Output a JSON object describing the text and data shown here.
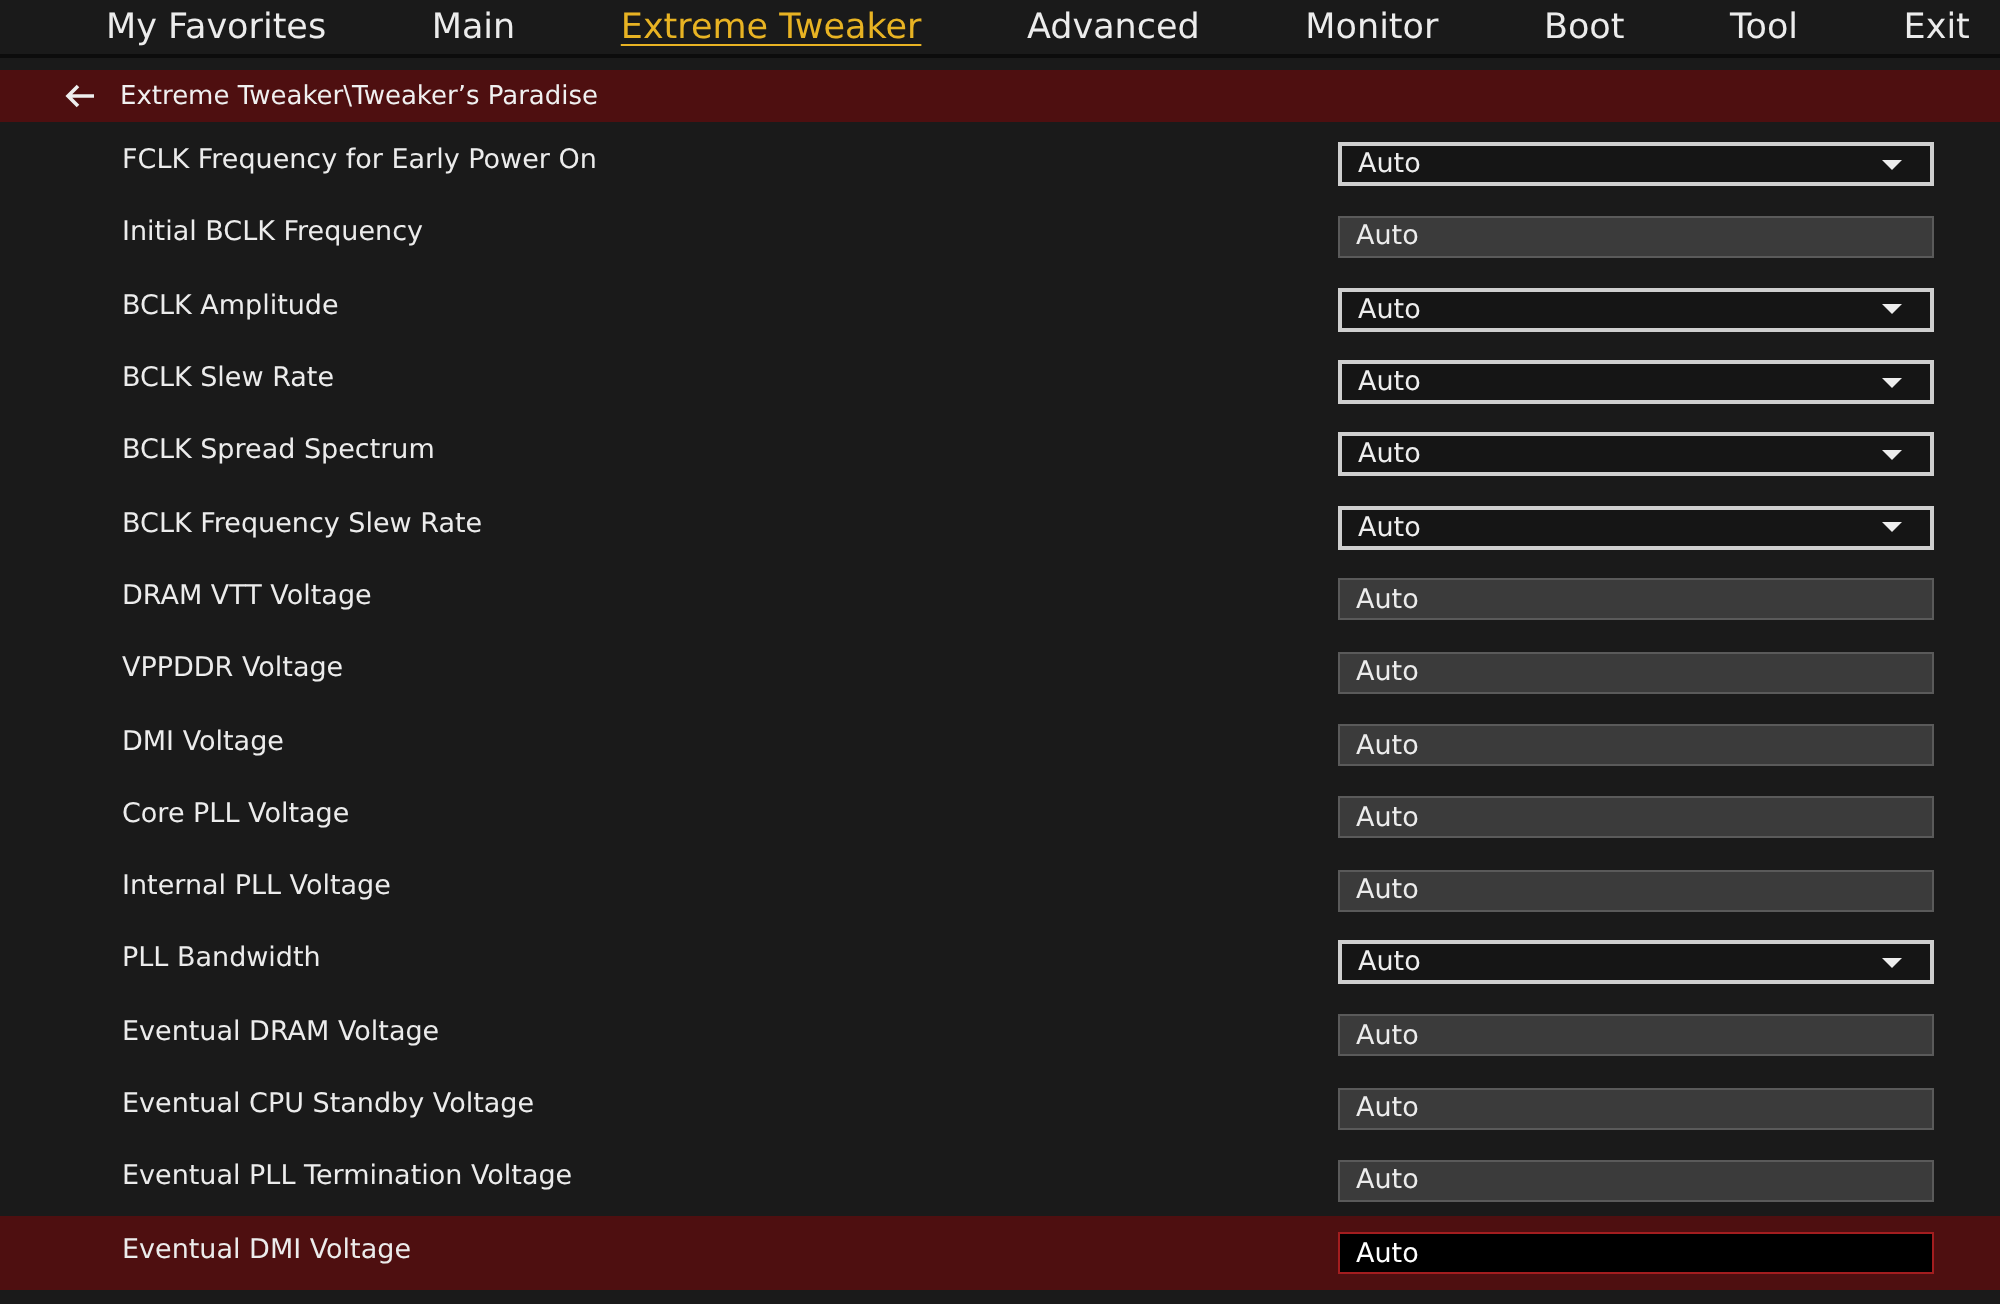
{
  "tabs": [
    {
      "label": "My Favorites",
      "selected": false
    },
    {
      "label": "Main",
      "selected": false
    },
    {
      "label": "Extreme Tweaker",
      "selected": true
    },
    {
      "label": "Advanced",
      "selected": false
    },
    {
      "label": "Monitor",
      "selected": false
    },
    {
      "label": "Boot",
      "selected": false
    },
    {
      "label": "Tool",
      "selected": false
    },
    {
      "label": "Exit",
      "selected": false
    }
  ],
  "breadcrumb": "Extreme Tweaker\\Tweaker’s Paradise",
  "settings": [
    {
      "label": "FCLK Frequency for Early Power On",
      "value": "Auto",
      "kind": "dropdown",
      "selected": false
    },
    {
      "label": "Initial BCLK Frequency",
      "value": "Auto",
      "kind": "field",
      "selected": false
    },
    {
      "label": "BCLK Amplitude",
      "value": "Auto",
      "kind": "dropdown",
      "selected": false
    },
    {
      "label": "BCLK Slew Rate",
      "value": "Auto",
      "kind": "dropdown",
      "selected": false
    },
    {
      "label": "BCLK Spread Spectrum",
      "value": "Auto",
      "kind": "dropdown",
      "selected": false
    },
    {
      "label": "BCLK Frequency Slew Rate",
      "value": "Auto",
      "kind": "dropdown",
      "selected": false
    },
    {
      "label": "DRAM VTT Voltage",
      "value": "Auto",
      "kind": "field",
      "selected": false
    },
    {
      "label": "VPPDDR Voltage",
      "value": "Auto",
      "kind": "field",
      "selected": false
    },
    {
      "label": "DMI Voltage",
      "value": "Auto",
      "kind": "field",
      "selected": false
    },
    {
      "label": "Core PLL Voltage",
      "value": "Auto",
      "kind": "field",
      "selected": false
    },
    {
      "label": "Internal PLL Voltage",
      "value": "Auto",
      "kind": "field",
      "selected": false
    },
    {
      "label": "PLL Bandwidth",
      "value": "Auto",
      "kind": "dropdown",
      "selected": false
    },
    {
      "label": "Eventual DRAM Voltage",
      "value": "Auto",
      "kind": "field",
      "selected": false
    },
    {
      "label": "Eventual CPU Standby Voltage",
      "value": "Auto",
      "kind": "field",
      "selected": false
    },
    {
      "label": "Eventual PLL Termination Voltage",
      "value": "Auto",
      "kind": "field",
      "selected": false
    },
    {
      "label": "Eventual DMI Voltage",
      "value": "Auto",
      "kind": "field",
      "selected": true
    }
  ]
}
